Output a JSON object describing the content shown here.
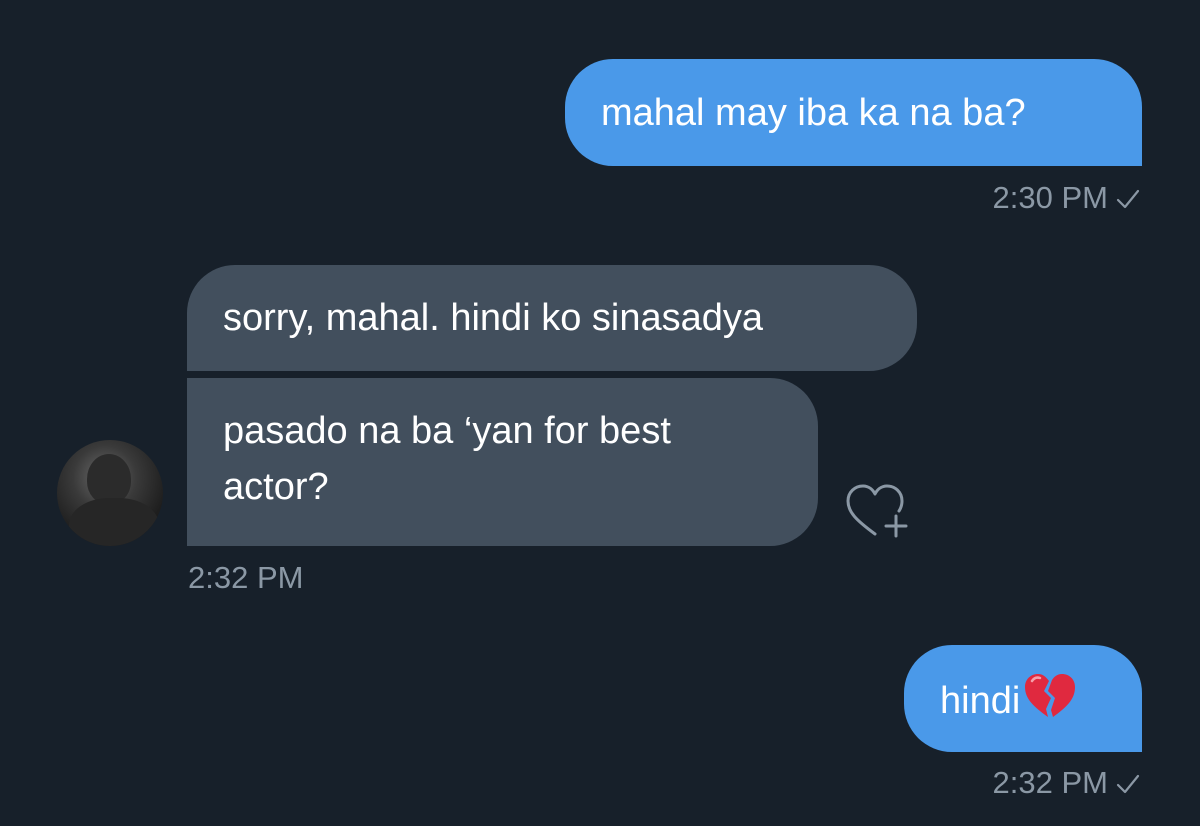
{
  "messages": [
    {
      "direction": "outgoing",
      "text": "mahal may iba ka na ba?",
      "time": "2:30 PM",
      "status": "sent-check"
    },
    {
      "direction": "incoming",
      "text": "sorry, mahal. hindi ko sinasadya"
    },
    {
      "direction": "incoming",
      "text_line1": "pasado na ba ‘yan for best",
      "text_line2": "actor?",
      "time": "2:32 PM"
    },
    {
      "direction": "outgoing",
      "text": "hindi",
      "emoji": "broken-heart",
      "time": "2:32 PM",
      "status": "sent-check"
    }
  ],
  "icons": {
    "check": "checkmark-icon",
    "react": "heart-plus-icon",
    "emoji": "broken-heart-icon"
  },
  "colors": {
    "background": "#17202a",
    "outgoing_bubble": "#4a99e9",
    "incoming_bubble": "#424f5d",
    "timestamp": "#8b98a5"
  }
}
